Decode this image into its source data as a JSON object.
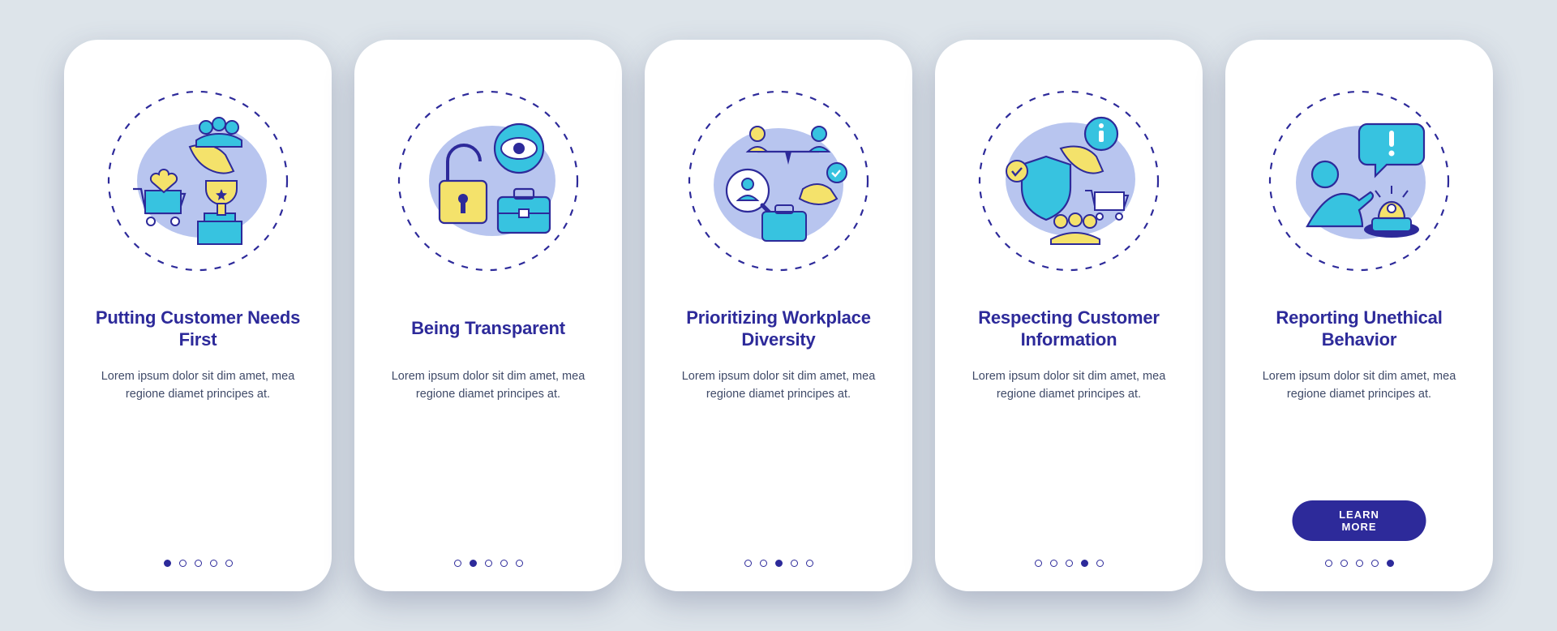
{
  "colors": {
    "bg": "#dde4ea",
    "primary": "#2d2a9a",
    "accentBlue": "#37c3e0",
    "accentYellow": "#f4e26b",
    "lightBlue": "#b8c5ef",
    "shadow": "rgba(60,70,110,0.28)"
  },
  "screens": [
    {
      "icon": "customer-needs-icon",
      "title": "Putting Customer Needs First",
      "body": "Lorem ipsum dolor sit dim amet, mea regione diamet principes at.",
      "active_dot": 0,
      "cta": null
    },
    {
      "icon": "transparent-icon",
      "title": "Being Transparent",
      "body": "Lorem ipsum dolor sit dim amet, mea regione diamet principes at.",
      "active_dot": 1,
      "cta": null
    },
    {
      "icon": "diversity-icon",
      "title": "Prioritizing Workplace Diversity",
      "body": "Lorem ipsum dolor sit dim amet, mea regione diamet principes at.",
      "active_dot": 2,
      "cta": null
    },
    {
      "icon": "information-icon",
      "title": "Respecting Customer Information",
      "body": "Lorem ipsum dolor sit dim amet, mea regione diamet principes at.",
      "active_dot": 3,
      "cta": null
    },
    {
      "icon": "reporting-icon",
      "title": "Reporting Unethical Behavior",
      "body": "Lorem ipsum dolor sit dim amet, mea regione diamet principes at.",
      "active_dot": 4,
      "cta": "LEARN MORE"
    }
  ],
  "dots_total": 5
}
